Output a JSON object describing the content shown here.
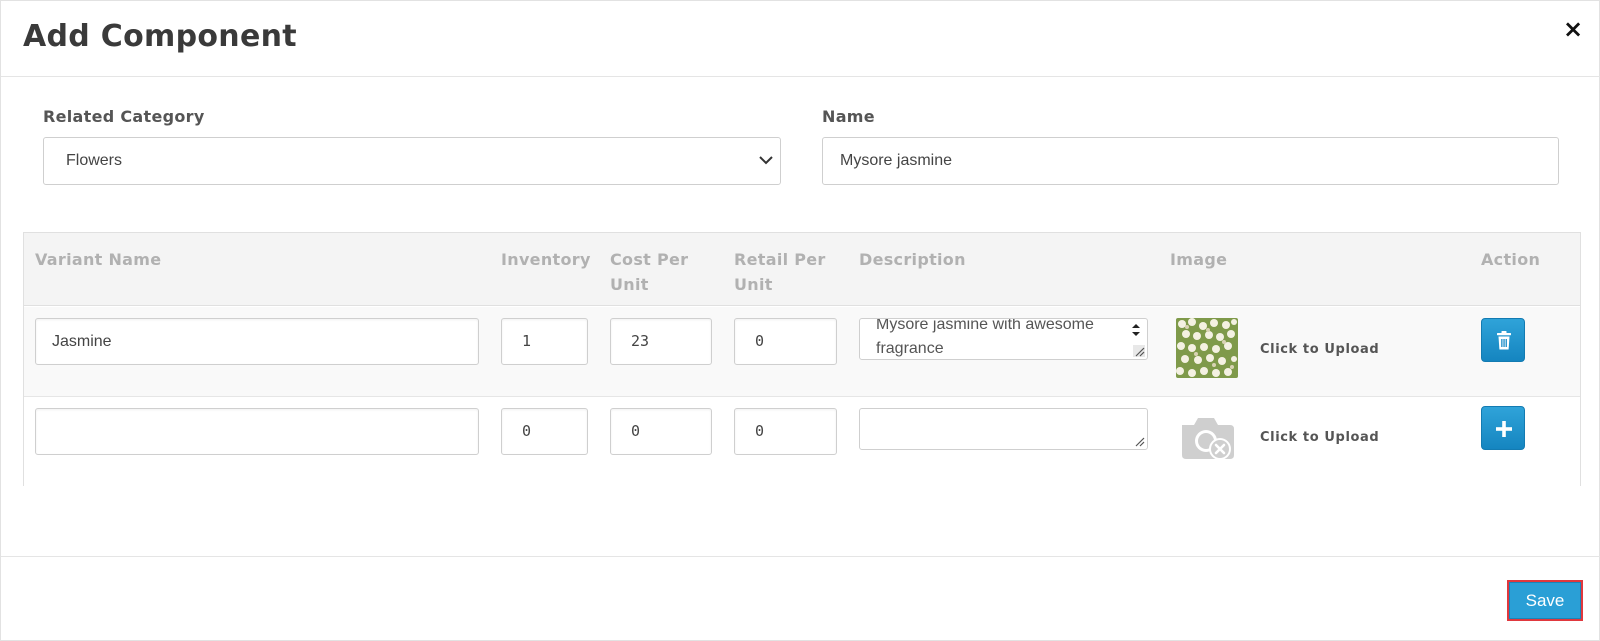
{
  "modal": {
    "title": "Add Component",
    "close_glyph": "×"
  },
  "form": {
    "category_label": "Related Category",
    "category_value": "Flowers",
    "name_label": "Name",
    "name_value": "Mysore jasmine"
  },
  "table": {
    "headers": {
      "variant_name": "Variant Name",
      "inventory": "Inventory",
      "cost_per_unit_line1": "Cost Per",
      "cost_per_unit_line2": "Unit",
      "retail_per_unit_line1": "Retail Per",
      "retail_per_unit_line2": "Unit",
      "description": "Description",
      "image": "Image",
      "action": "Action"
    },
    "rows": [
      {
        "variant_name": "Jasmine",
        "inventory": "1",
        "cost_per_unit": "23",
        "retail_per_unit": "0",
        "description": "Mysore jasmine with awesome fragrance",
        "image_icon": "jasmine-thumbnail",
        "upload_label": "Click to Upload",
        "action_icon": "trash-icon"
      },
      {
        "variant_name": "",
        "inventory": "0",
        "cost_per_unit": "0",
        "retail_per_unit": "0",
        "description": "",
        "image_icon": "camera-remove-icon",
        "upload_label": "Click to Upload",
        "action_icon": "plus-icon"
      }
    ]
  },
  "footer": {
    "save_label": "Save"
  },
  "colors": {
    "accent": "#2a9fd6",
    "save_border": "#e0383e",
    "header_text": "#b1b1b1"
  }
}
